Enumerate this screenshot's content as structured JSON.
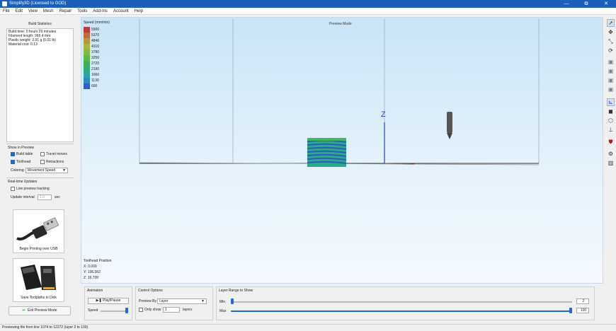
{
  "window": {
    "title": "Simplify3D (Licensed to GOD)",
    "minimize": "—",
    "maximize": "⧉",
    "close": "✕"
  },
  "menu": [
    "File",
    "Edit",
    "View",
    "Mesh",
    "Repair",
    "Tools",
    "Add-Ins",
    "Account",
    "Help"
  ],
  "build_stats": {
    "title": "Build Statistics",
    "lines": [
      "Build time: 0 hours 29 minutes",
      "Filament length: 966.4 mm",
      "Plastic weight: 2.91 g (0.01 lb)",
      "Material cost: 0.13"
    ]
  },
  "show_in_preview": {
    "title": "Show in Preview",
    "build_table": "Build table",
    "travel_moves": "Travel moves",
    "toolhead": "Toolhead",
    "retractions": "Retractions",
    "coloring_label": "Coloring",
    "coloring_value": "Movement Speed"
  },
  "realtime": {
    "title": "Real-time Updates",
    "live_tracking": "Live preview tracking",
    "interval_label": "Update interval",
    "interval_value": "1.0",
    "interval_unit": "sec"
  },
  "usb_button": {
    "label": "Begin Printing over USB"
  },
  "save_button": {
    "label": "Save Toolpaths to Disk"
  },
  "exit_button": {
    "label": "Exit Preview Mode"
  },
  "viewport": {
    "mode_label": "Preview Mode",
    "legend_title": "Speed (mm/min)",
    "legend": [
      {
        "value": "5900",
        "color": "#c0393b"
      },
      {
        "value": "5370",
        "color": "#c26a3a"
      },
      {
        "value": "4840",
        "color": "#b8963a"
      },
      {
        "value": "4310",
        "color": "#a9b63a"
      },
      {
        "value": "3780",
        "color": "#86b93d"
      },
      {
        "value": "3250",
        "color": "#5fb842"
      },
      {
        "value": "2720",
        "color": "#3db24c"
      },
      {
        "value": "2190",
        "color": "#2eae78"
      },
      {
        "value": "1660",
        "color": "#2aa8a0"
      },
      {
        "value": "1130",
        "color": "#2a8cc0"
      },
      {
        "value": "600",
        "color": "#2a64c6"
      }
    ],
    "axis_label": "Z",
    "toolhead": {
      "title": "Toolhead Position",
      "x": "X: 0.000",
      "y": "Y: 106.052",
      "z": "Z: 16.700"
    }
  },
  "animation": {
    "title": "Animation",
    "play_label": "Play/Pause",
    "speed_label": "Speed"
  },
  "control": {
    "title": "Control Options",
    "preview_by_label": "Preview By",
    "preview_by_value": "Layer",
    "only_show": "Only show",
    "only_show_value": "1",
    "layers": "layers"
  },
  "layer_range": {
    "title": "Layer Range to Show",
    "min_label": "Min",
    "max_label": "Max",
    "min_value": "2",
    "max_value": "100",
    "min_fraction": 0.0,
    "max_fraction": 1.0
  },
  "toolbar_icons": [
    "select-arrow-icon",
    "move-icon",
    "scale-icon",
    "rotate-icon",
    "view-iso-icon",
    "view-front-icon",
    "view-side-icon",
    "view-top-icon",
    "axes-icon",
    "cube-icon",
    "wire-cube-icon",
    "section-icon",
    "shield-icon",
    "gear-icon",
    "supports-icon"
  ],
  "status": {
    "text": "Previewing file from line 1074 to 12272 (layer 2 to 100)"
  }
}
